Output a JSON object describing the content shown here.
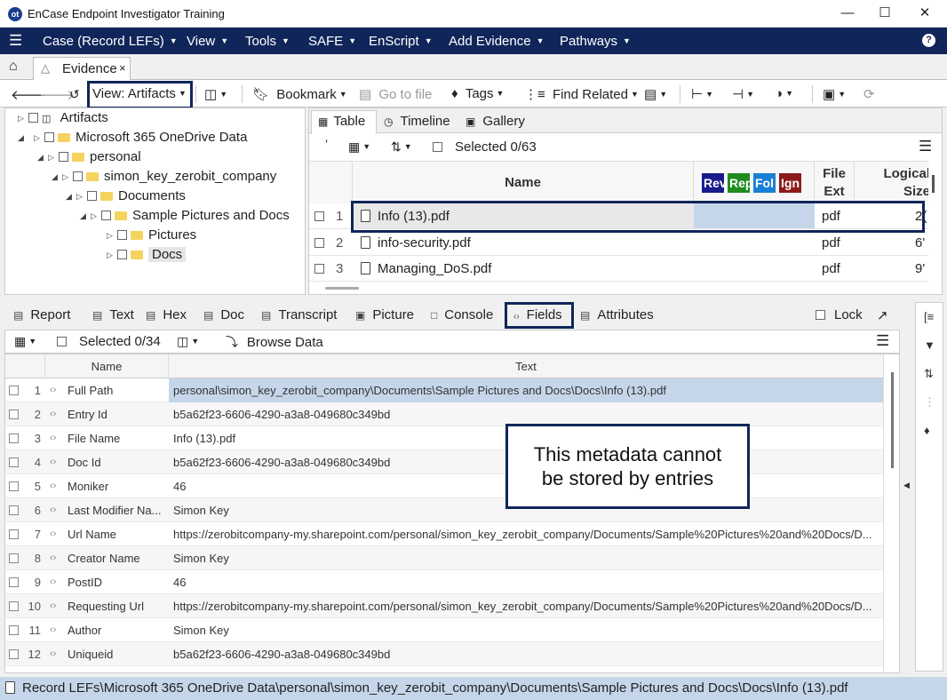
{
  "window": {
    "title": "EnCase Endpoint Investigator Training",
    "controls": [
      "minimize-icon",
      "maximize-icon",
      "close-icon"
    ]
  },
  "menu": [
    {
      "label": "Case (Record LEFs)"
    },
    {
      "label": "View"
    },
    {
      "label": "Tools"
    },
    {
      "label": "SAFE"
    },
    {
      "label": "EnScript"
    },
    {
      "label": "Add Evidence"
    },
    {
      "label": "Pathways"
    }
  ],
  "tabs": {
    "evidence_label": "Evidence",
    "close_glyph": "×"
  },
  "toolbar": {
    "view_label": "View: Artifacts",
    "bookmark_label": "Bookmark",
    "goto_label": "Go to file",
    "tags_label": "Tags",
    "find_related_label": "Find Related"
  },
  "tree": {
    "items": [
      {
        "label": "Artifacts",
        "depth": 0
      },
      {
        "label": "Microsoft 365 OneDrive Data",
        "depth": 1
      },
      {
        "label": "personal",
        "depth": 2
      },
      {
        "label": "simon_key_zerobit_company",
        "depth": 3
      },
      {
        "label": "Documents",
        "depth": 4
      },
      {
        "label": "Sample Pictures and Docs",
        "depth": 5
      },
      {
        "label": "Pictures",
        "depth": 6
      },
      {
        "label": "Docs",
        "depth": 6
      }
    ]
  },
  "table_view": {
    "tabs": [
      "Table",
      "Timeline",
      "Gallery"
    ],
    "selected_label": "Selected 0/63",
    "headers": {
      "name": "Name",
      "tag_badges": [
        {
          "label": "Rev",
          "color": "#1a1a8c"
        },
        {
          "label": "Rep",
          "color": "#1e8c1e"
        },
        {
          "label": "Fol",
          "color": "#1a7fd6"
        },
        {
          "label": "Ign",
          "color": "#8c1a1a"
        }
      ],
      "file_ext": "File Ext",
      "logical_size": "Logical Size"
    },
    "rows": [
      {
        "num": "1",
        "name": "Info (13).pdf",
        "ext": "pdf",
        "size": "2("
      },
      {
        "num": "2",
        "name": "info-security.pdf",
        "ext": "pdf",
        "size": "6'"
      },
      {
        "num": "3",
        "name": "Managing_DoS.pdf",
        "ext": "pdf",
        "size": "9'"
      }
    ]
  },
  "lower_tabs": [
    {
      "label": "Report"
    },
    {
      "label": "Text"
    },
    {
      "label": "Hex"
    },
    {
      "label": "Doc"
    },
    {
      "label": "Transcript"
    },
    {
      "label": "Picture"
    },
    {
      "label": "Console"
    },
    {
      "label": "Fields"
    },
    {
      "label": "Attributes"
    }
  ],
  "lock_label": "Lock",
  "fields": {
    "selected_label": "Selected 0/34",
    "browse_label": "Browse Data",
    "col_name": "Name",
    "col_text": "Text",
    "rows": [
      {
        "num": "1",
        "name": "Full Path",
        "text": "personal\\simon_key_zerobit_company\\Documents\\Sample Pictures and Docs\\Docs\\Info (13).pdf"
      },
      {
        "num": "2",
        "name": "Entry Id",
        "text": "b5a62f23-6606-4290-a3a8-049680c349bd"
      },
      {
        "num": "3",
        "name": "File Name",
        "text": "Info (13).pdf"
      },
      {
        "num": "4",
        "name": "Doc Id",
        "text": "b5a62f23-6606-4290-a3a8-049680c349bd"
      },
      {
        "num": "5",
        "name": "Moniker",
        "text": "46"
      },
      {
        "num": "6",
        "name": "Last Modifier Na...",
        "text": "Simon Key"
      },
      {
        "num": "7",
        "name": "Url Name",
        "text": "https://zerobitcompany-my.sharepoint.com/personal/simon_key_zerobit_company/Documents/Sample%20Pictures%20and%20Docs/D..."
      },
      {
        "num": "8",
        "name": "Creator Name",
        "text": "Simon Key"
      },
      {
        "num": "9",
        "name": "PostID",
        "text": "46"
      },
      {
        "num": "10",
        "name": "Requesting Url",
        "text": "https://zerobitcompany-my.sharepoint.com/personal/simon_key_zerobit_company/Documents/Sample%20Pictures%20and%20Docs/D..."
      },
      {
        "num": "11",
        "name": "Author",
        "text": "Simon Key"
      },
      {
        "num": "12",
        "name": "Uniqueid",
        "text": "b5a62f23-6606-4290-a3a8-049680c349bd"
      }
    ]
  },
  "callout": {
    "line1": "This metadata cannot",
    "line2": "be stored by entries"
  },
  "status": {
    "path": "Record LEFs\\Microsoft 365 OneDrive Data\\personal\\simon_key_zerobit_company\\Documents\\Sample Pictures and Docs\\Docs\\Info (13).pdf"
  },
  "colors": {
    "menubar": "#10265a",
    "highlight_border": "#10265a",
    "selected_row": "#c5d6ea",
    "statusbar": "#c5d6ea"
  }
}
